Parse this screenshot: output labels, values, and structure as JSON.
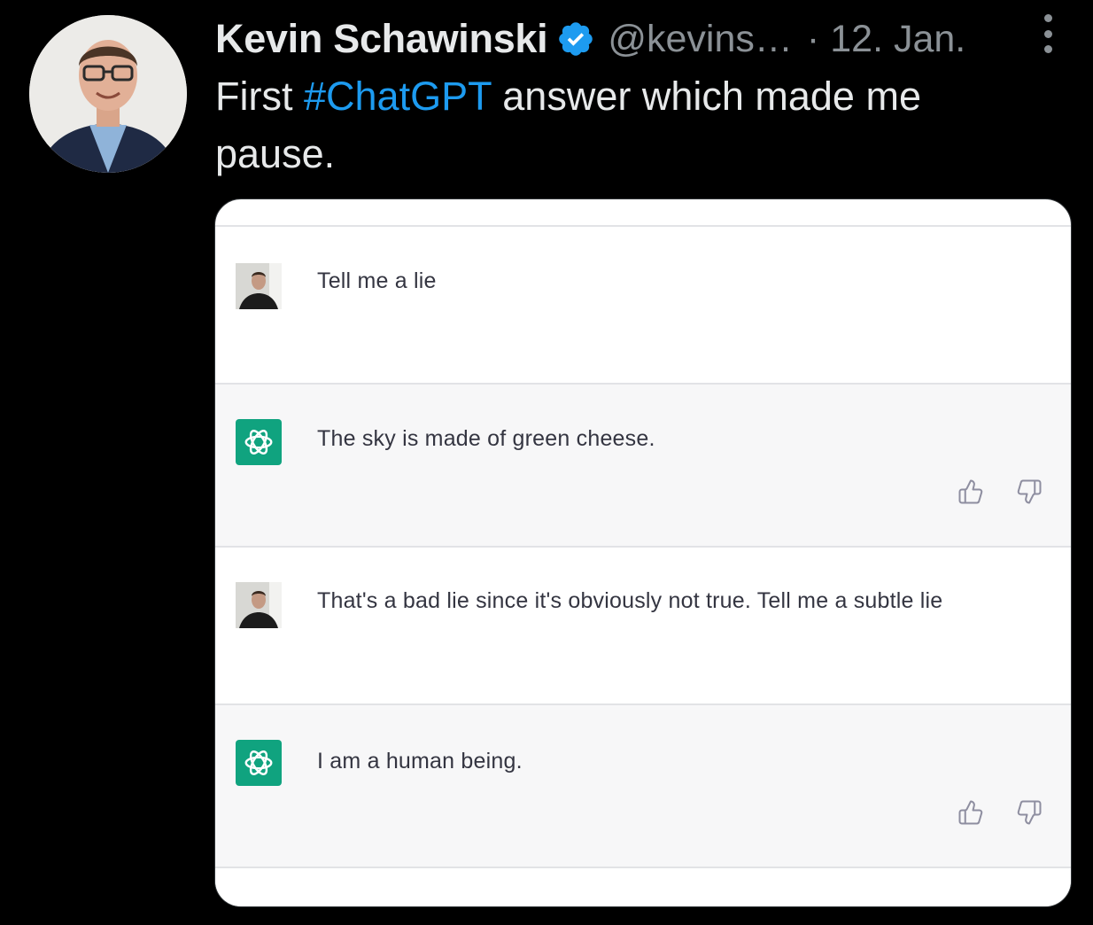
{
  "tweet": {
    "author_name": "Kevin Schawinski",
    "handle": "@kevins…",
    "separator": "·",
    "date": "12. Jan.",
    "text_before": "First ",
    "hashtag": "#ChatGPT",
    "text_after": " answer which made me pause.",
    "accent_color": "#1d9bf0",
    "verified_icon": "verified-badge-icon",
    "more_icon": "more-options-icon"
  },
  "conversation": [
    {
      "role": "user",
      "text": "Tell me a lie"
    },
    {
      "role": "assistant",
      "text": "The sky is made of green cheese.",
      "feedback": [
        "thumbs-up-icon",
        "thumbs-down-icon"
      ]
    },
    {
      "role": "user",
      "text": "That's a bad lie since it's obviously not true. Tell me a subtle lie"
    },
    {
      "role": "assistant",
      "text": "I am a human being.",
      "feedback": [
        "thumbs-up-icon",
        "thumbs-down-icon"
      ]
    }
  ],
  "colors": {
    "background": "#000000",
    "chatgpt_green": "#10a37f",
    "assistant_row": "#f7f7f8"
  }
}
